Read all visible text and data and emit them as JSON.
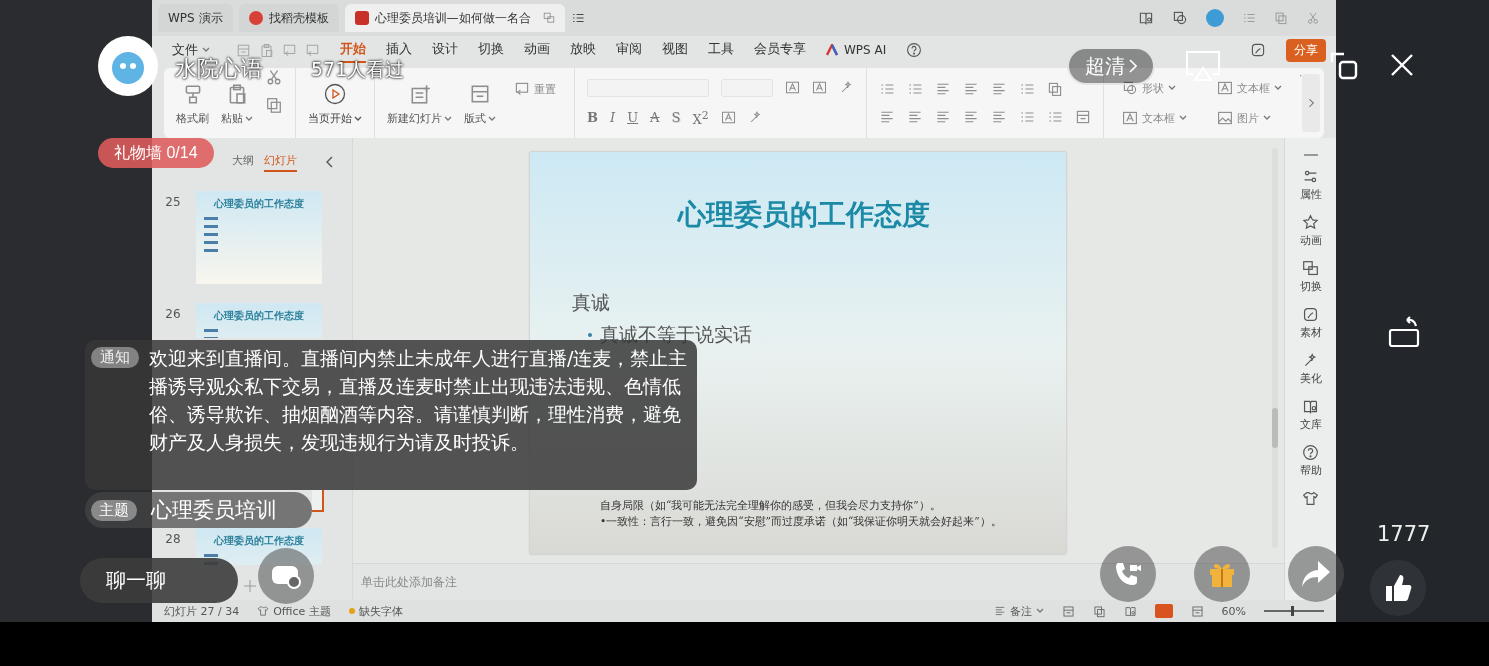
{
  "stream": {
    "host_name": "水院心语",
    "viewers": "571人看过",
    "quality": "超清",
    "gift_wall": "礼物墙 0/14",
    "notice": {
      "tag": "通知",
      "text": "欢迎来到直播间。直播间内禁止未成年人进行直播/连麦，禁止主播诱导观众私下交易，直播及连麦时禁止出现违法违规、色情低俗、诱导欺诈、抽烟酗酒等内容。请谨慎判断，理性消费，避免财产及人身损失，发现违规行为请及时投诉。"
    },
    "topic": {
      "tag": "主题",
      "text": "心理委员培训"
    },
    "chat": "聊一聊",
    "likes": "1777"
  },
  "app": {
    "tabs": [
      {
        "label": "WPS 演示",
        "kind": "home",
        "selected": false
      },
      {
        "label": "找稻壳模板",
        "kind": "template",
        "selected": false
      },
      {
        "label": "心理委员培训—如何做一名合",
        "kind": "document",
        "selected": true
      }
    ],
    "menu": {
      "file": "文件",
      "tabs": [
        {
          "label": "开始",
          "selected": true
        },
        {
          "label": "插入",
          "selected": false
        },
        {
          "label": "设计",
          "selected": false
        },
        {
          "label": "切换",
          "selected": false
        },
        {
          "label": "动画",
          "selected": false
        },
        {
          "label": "放映",
          "selected": false
        },
        {
          "label": "审阅",
          "selected": false
        },
        {
          "label": "视图",
          "selected": false
        },
        {
          "label": "工具",
          "selected": false
        },
        {
          "label": "会员专享",
          "selected": false
        }
      ],
      "ai": "WPS AI",
      "share": "分享"
    },
    "ribbon": {
      "clipboard": [
        {
          "label": "格式刷",
          "kind": "brush",
          "dropdown": false
        },
        {
          "label": "粘贴",
          "kind": "paste",
          "dropdown": true
        }
      ],
      "play": {
        "label": "当页开始",
        "dropdown": true
      },
      "slides": [
        {
          "label": "新建幻灯片",
          "kind": "new-slide",
          "dropdown": true
        },
        {
          "label": "版式",
          "kind": "layout",
          "dropdown": true
        }
      ],
      "reset": "重置",
      "format": [
        {
          "label": "B",
          "kind": "bold"
        },
        {
          "label": "I",
          "kind": "italic"
        },
        {
          "label": "U",
          "kind": "underline"
        },
        {
          "label": "A",
          "kind": "strike"
        },
        {
          "label": "S",
          "kind": "shadow"
        },
        {
          "label": "X$^{2}$",
          "kind": "superscript"
        }
      ],
      "insert": [
        {
          "label": "形状",
          "kind": "shape",
          "dropdown": true
        },
        {
          "label": "文本框",
          "kind": "textbox",
          "dropdown": true
        },
        {
          "label": "文本框",
          "kind": "textbox",
          "dropdown": true
        },
        {
          "label": "图片",
          "kind": "picture",
          "dropdown": true
        }
      ]
    },
    "panel": {
      "tabs": [
        {
          "label": "大纲",
          "selected": false
        },
        {
          "label": "幻灯片",
          "selected": true
        }
      ],
      "slides": [
        {
          "number": "25",
          "title": "心理委员的工作态度",
          "selected": false
        },
        {
          "number": "26",
          "title": "心理委员的工作态度",
          "selected": false
        },
        {
          "selected": true
        },
        {
          "number": "28",
          "title": "心理委员的工作态度",
          "selected": false
        }
      ]
    },
    "slide": {
      "title": "心理委员的工作态度",
      "heading": "真诚",
      "bullets": [
        "真诚不等于说实话"
      ],
      "paragraphs": [
        "自身局限（如“我可能无法完全理解你的感受，但我会尽力支持你”）。",
        "•一致性：言行一致，避免因“安慰”而过度承诺（如“我保证你明天就会好起来”）。"
      ]
    },
    "notes_placeholder": "单击此处添加备注",
    "sidebar": [
      {
        "label": "属性",
        "kind": "properties"
      },
      {
        "label": "动画",
        "kind": "animation"
      },
      {
        "label": "切换",
        "kind": "transition"
      },
      {
        "label": "素材",
        "kind": "material"
      },
      {
        "label": "美化",
        "kind": "beautify"
      },
      {
        "label": "文库",
        "kind": "library"
      },
      {
        "label": "帮助",
        "kind": "help"
      }
    ],
    "status": {
      "slides": "幻灯片 27 / 34",
      "theme": "Office 主题",
      "fonts": "缺失字体",
      "notes": "备注",
      "zoom": "60%",
      "zoom_slider": {
        "level": 0.45
      }
    }
  }
}
